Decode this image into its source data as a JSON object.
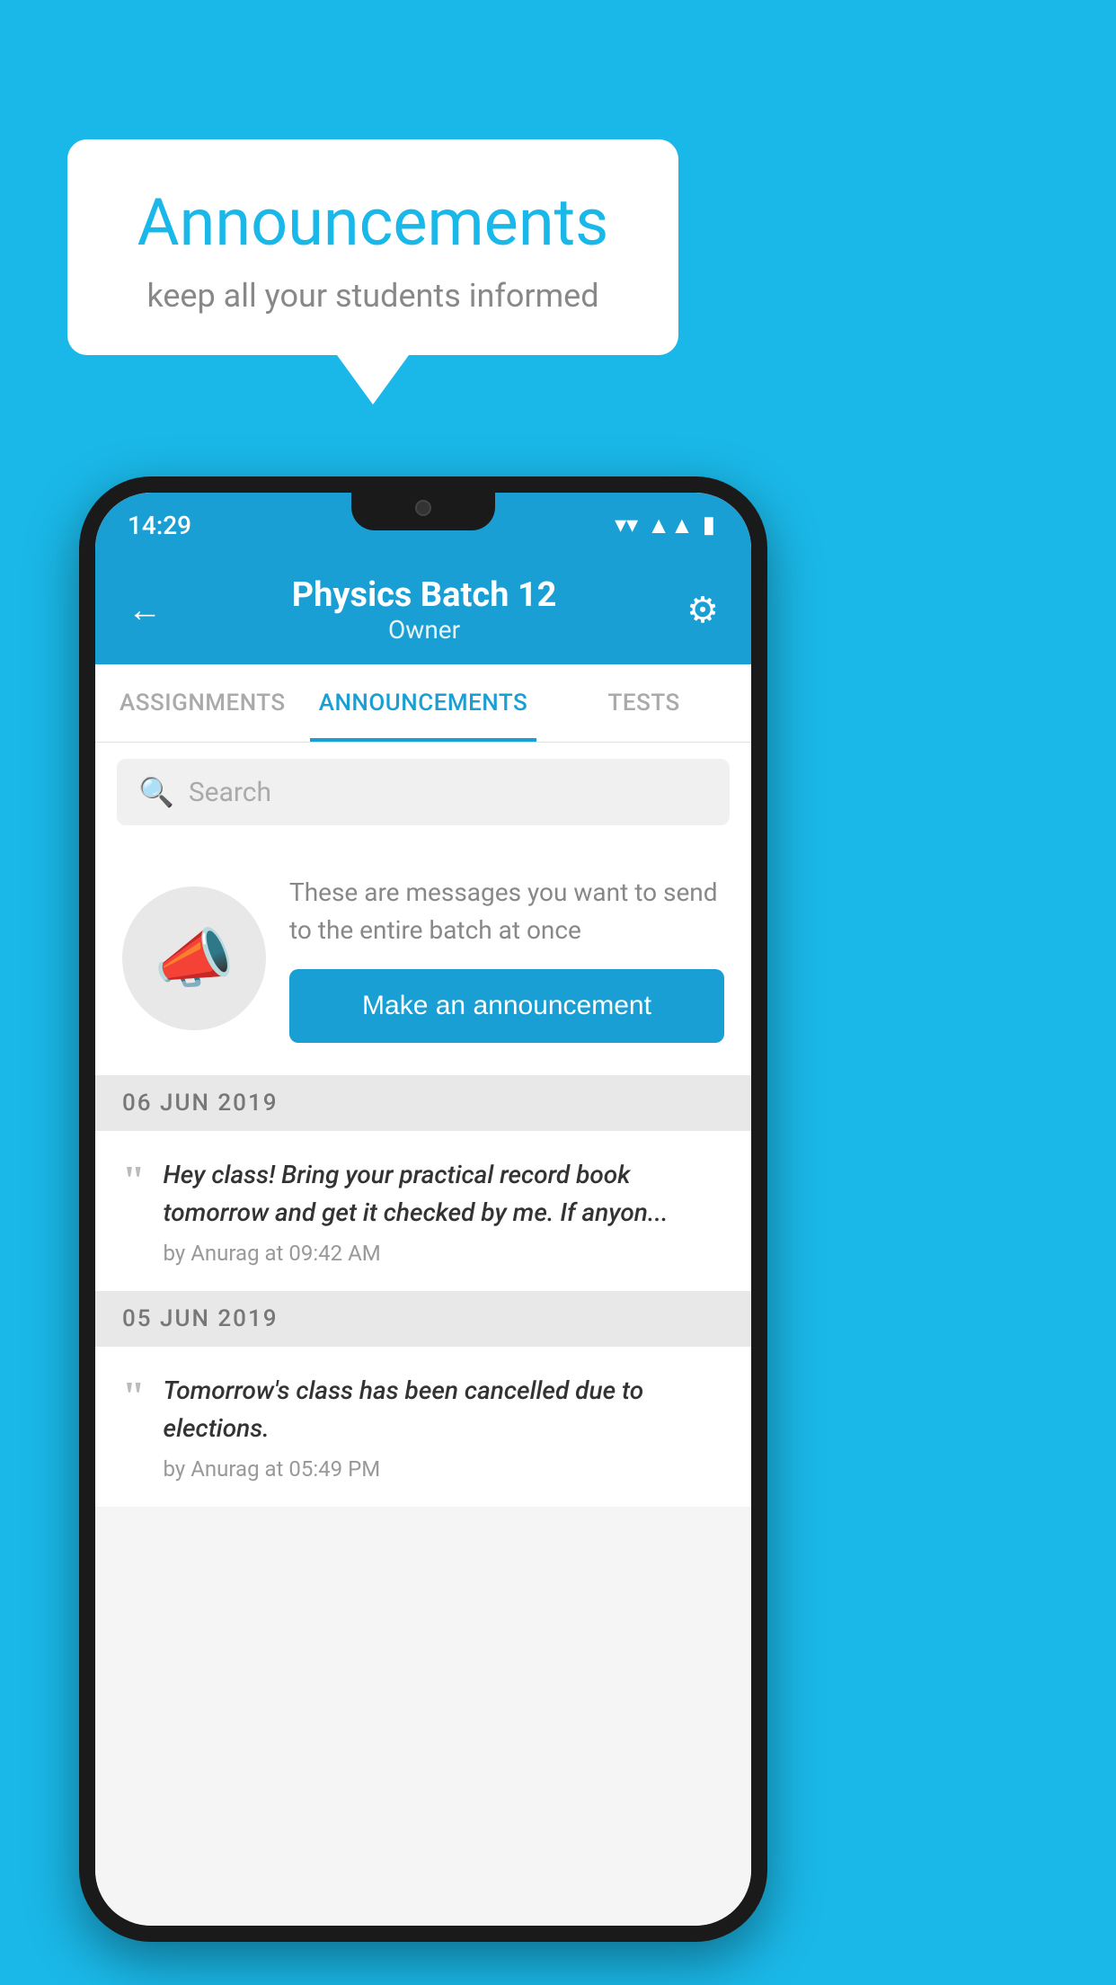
{
  "background": {
    "color": "#1ab8e8"
  },
  "speech_bubble": {
    "title": "Announcements",
    "subtitle": "keep all your students informed"
  },
  "status_bar": {
    "time": "14:29",
    "wifi": "▼",
    "signal": "▲",
    "battery": "▮"
  },
  "header": {
    "back_label": "←",
    "title": "Physics Batch 12",
    "subtitle": "Owner",
    "gear_label": "⚙"
  },
  "tabs": [
    {
      "label": "ASSIGNMENTS",
      "active": false
    },
    {
      "label": "ANNOUNCEMENTS",
      "active": true
    },
    {
      "label": "TESTS",
      "active": false
    },
    {
      "label": "...",
      "active": false
    }
  ],
  "search": {
    "placeholder": "Search"
  },
  "announcement_prompt": {
    "description": "These are messages you want to send to the entire batch at once",
    "button_label": "Make an announcement"
  },
  "date_sections": [
    {
      "date": "06  JUN  2019",
      "items": [
        {
          "text": "Hey class! Bring your practical record book tomorrow and get it checked by me. If anyon...",
          "meta": "by Anurag at 09:42 AM"
        }
      ]
    },
    {
      "date": "05  JUN  2019",
      "items": [
        {
          "text": "Tomorrow's class has been cancelled due to elections.",
          "meta": "by Anurag at 05:49 PM"
        }
      ]
    }
  ]
}
